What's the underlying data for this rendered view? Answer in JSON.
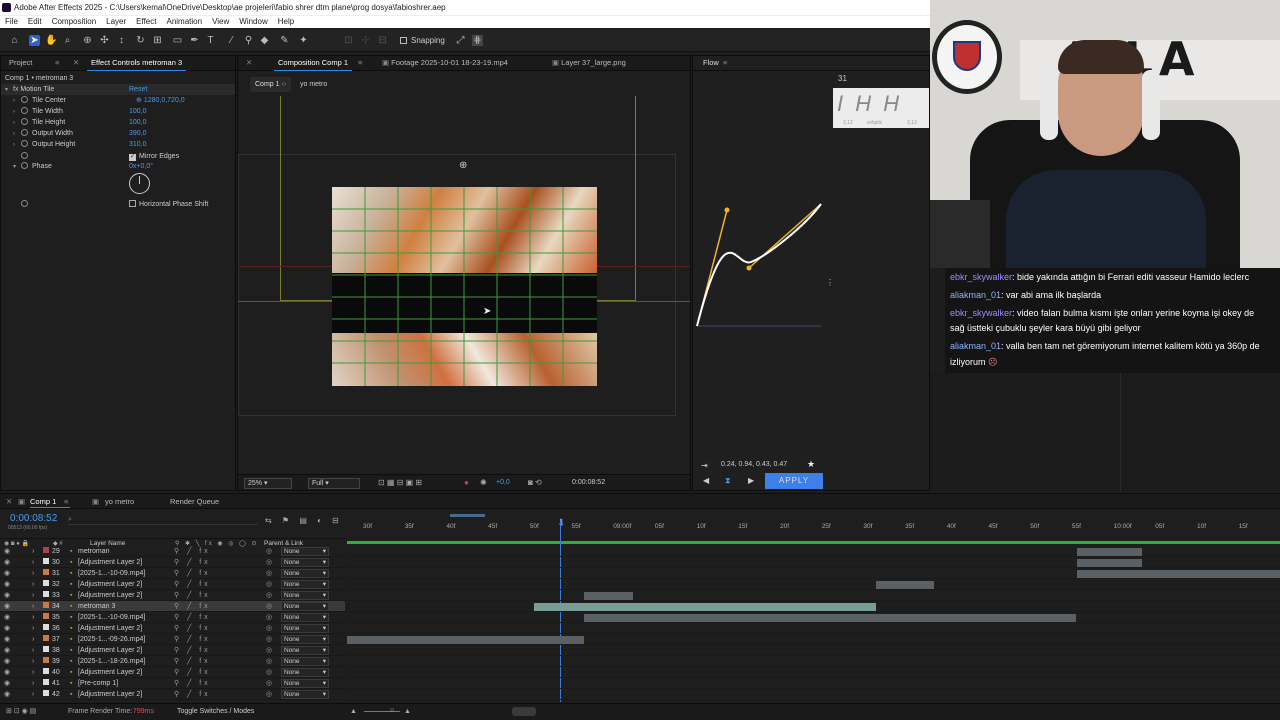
{
  "window": {
    "title": "Adobe After Effects 2025 - C:\\Users\\kemal\\OneDrive\\Desktop\\ae projeleri\\fabio shrer dtm plane\\prog dosya\\fabioshrer.aep"
  },
  "menu": [
    "File",
    "Edit",
    "Composition",
    "Layer",
    "Effect",
    "Animation",
    "View",
    "Window",
    "Help"
  ],
  "toolbar": {
    "snapping_label": "Snapping"
  },
  "project_panel": {
    "tab_project": "Project",
    "tab_effect_controls": "Effect Controls metroman 3",
    "breadcrumb": "Comp 1 • metroman 3",
    "effect_name": "Motion Tile",
    "reset_label": "Reset",
    "properties": [
      {
        "name": "Tile Center",
        "value": "1280,0,720,0"
      },
      {
        "name": "Tile Width",
        "value": "100,0"
      },
      {
        "name": "Tile Height",
        "value": "100,0"
      },
      {
        "name": "Output Width",
        "value": "390,0"
      },
      {
        "name": "Output Height",
        "value": "310,0"
      }
    ],
    "mirror_edges_label": "Mirror Edges",
    "phase_label": "Phase",
    "phase_value": "0x+0,0°",
    "horizontal_phase_label": "Horizontal Phase Shift"
  },
  "comp_panel": {
    "tabs": [
      "Composition Comp 1",
      "Footage 2025-10-01 18-23-19.mp4",
      "Layer 37_large.png"
    ],
    "crumb_comp": "Comp 1",
    "crumb_layer": "yo metro",
    "zoom": "25%",
    "resolution": "Full",
    "exposure": "+0,0",
    "timecode": "0:00:08:52"
  },
  "flow_panel": {
    "title": "Flow",
    "preset_number": "31",
    "curve_values": "0.24, 0.94, 0.43, 0.47",
    "apply_label": "APPLY",
    "preset_sub1": "3,12",
    "preset_sub2": "ecliptic",
    "preset_sub3": "3,13"
  },
  "chat": [
    {
      "user": "ebkr_skywalker",
      "text": ": bide yakında attığın bi Ferrari editi vasseur Hamido leclerc",
      "color": "#9c8cff"
    },
    {
      "user": "aliakman_01",
      "text": ": var abi ama ilk başlarda",
      "color": "#8fb3ff"
    },
    {
      "user": "ebkr_skywalker",
      "text": ": video falan bulma kısmı işte onları yerine koyma işi okey de",
      "color": "#9c8cff"
    },
    {
      "user": "",
      "text": "sağ üstteki çubuklu şeyler kara büyü gibi geliyor",
      "color": ""
    },
    {
      "user": "aliakman_01",
      "text": ": valla ben tam net göremiyorum internet kalitem kötü ya 360p de",
      "color": "#8fb3ff"
    },
    {
      "user": "",
      "text": "izliyorum",
      "color": ""
    }
  ],
  "timeline": {
    "tabs": [
      "Comp 1",
      "yo metro",
      "Render Queue"
    ],
    "timecode": "0:00:08:52",
    "timecode_sub": "00513 (60.00 fps)",
    "col_layer_name": "Layer Name",
    "col_parent": "Parent & Link",
    "ruler": [
      "30f",
      "35f",
      "40f",
      "45f",
      "50f",
      "55f",
      "09:00f",
      "05f",
      "10f",
      "15f",
      "20f",
      "25f",
      "30f",
      "35f",
      "40f",
      "45f",
      "50f",
      "55f",
      "10:00f",
      "05f",
      "10f",
      "15f"
    ],
    "layers": [
      {
        "num": "29",
        "name": "metroman",
        "parent": "None",
        "color": "#a44",
        "selected": false
      },
      {
        "num": "30",
        "name": "[Adjustment Layer 2]",
        "parent": "None",
        "color": "#ddd",
        "selected": false
      },
      {
        "num": "31",
        "name": "[2025-1...-10-09.mp4]",
        "parent": "None",
        "color": "#c74",
        "selected": false
      },
      {
        "num": "32",
        "name": "[Adjustment Layer 2]",
        "parent": "None",
        "color": "#ddd",
        "selected": false
      },
      {
        "num": "33",
        "name": "[Adjustment Layer 2]",
        "parent": "None",
        "color": "#ddd",
        "selected": false
      },
      {
        "num": "34",
        "name": "metroman 3",
        "parent": "None",
        "color": "#c74",
        "selected": true
      },
      {
        "num": "35",
        "name": "[2025-1...-10-09.mp4]",
        "parent": "None",
        "color": "#c74",
        "selected": false
      },
      {
        "num": "36",
        "name": "[Adjustment Layer 2]",
        "parent": "None",
        "color": "#ddd",
        "selected": false
      },
      {
        "num": "37",
        "name": "[2025-1...-09-26.mp4]",
        "parent": "None",
        "color": "#c74",
        "selected": false
      },
      {
        "num": "38",
        "name": "[Adjustment Layer 2]",
        "parent": "None",
        "color": "#ddd",
        "selected": false
      },
      {
        "num": "39",
        "name": "[2025-1...-18-26.mp4]",
        "parent": "None",
        "color": "#c74",
        "selected": false
      },
      {
        "num": "40",
        "name": "[Adjustment Layer 2]",
        "parent": "None",
        "color": "#ddd",
        "selected": false
      },
      {
        "num": "41",
        "name": "[Pre-comp 1]",
        "parent": "None",
        "color": "#ddd",
        "selected": false
      },
      {
        "num": "42",
        "name": "[Adjustment Layer 2]",
        "parent": "None",
        "color": "#ddd",
        "selected": false
      }
    ],
    "frame_render_label": "Frame Render Time:",
    "frame_render_value": "799ms",
    "toggle_label": "Toggle Switches / Modes"
  }
}
